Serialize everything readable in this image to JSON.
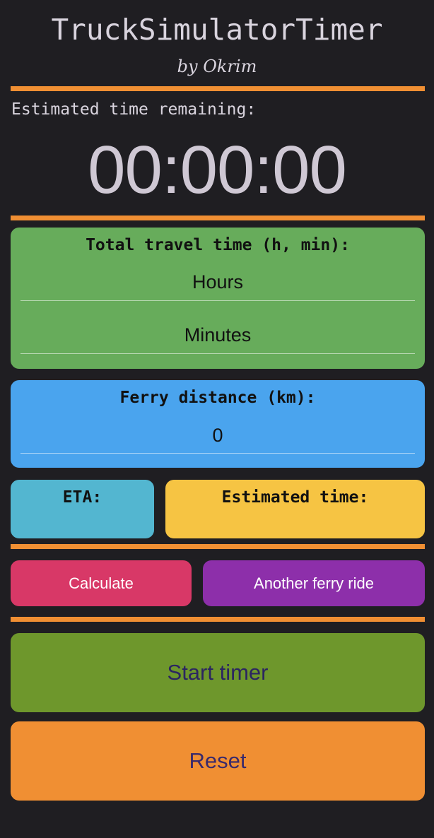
{
  "header": {
    "title": "TruckSimulatorTimer",
    "subtitle": "by Okrim"
  },
  "timer": {
    "label": "Estimated time remaining:",
    "display": "00:00:00"
  },
  "travel_time": {
    "title": "Total travel time (h, min):",
    "hours_placeholder": "Hours",
    "minutes_placeholder": "Minutes"
  },
  "ferry": {
    "title": "Ferry distance (km):",
    "value": "0"
  },
  "results": {
    "eta_label": "ETA:",
    "estimated_label": "Estimated time:"
  },
  "actions": {
    "calculate": "Calculate",
    "another_ferry": "Another ferry ride",
    "start": "Start timer",
    "reset": "Reset"
  },
  "colors": {
    "background": "#1f1e22",
    "accent": "#f08f33",
    "travel_card": "#67ac5b",
    "ferry_card": "#4aa4ee",
    "eta_card": "#53b6d0",
    "estimated_card": "#f6c443",
    "calculate_button": "#d83867",
    "ferry_button": "#8d2faa",
    "start_button": "#6e972c",
    "reset_button": "#f08f33"
  }
}
